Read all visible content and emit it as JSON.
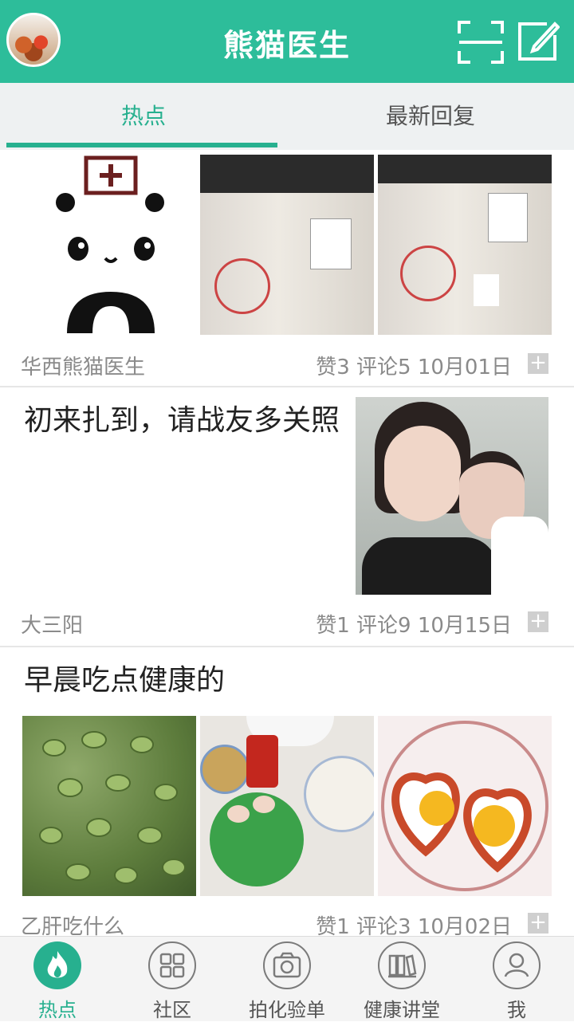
{
  "header": {
    "title": "熊猫医生"
  },
  "tabs": {
    "hot": "热点",
    "latest_reply": "最新回复"
  },
  "posts": [
    {
      "author": "华西熊猫医生",
      "stats": "赞3 评论5 10月01日"
    },
    {
      "title": "初来扎到，请战友多关照",
      "author": "大三阳",
      "stats": "赞1 评论9 10月15日"
    },
    {
      "title": "早晨吃点健康的",
      "author": "乙肝吃什么",
      "stats": "赞1 评论3 10月02日"
    }
  ],
  "nav": {
    "items": [
      {
        "label": "热点",
        "icon": "flame-icon"
      },
      {
        "label": "社区",
        "icon": "grid-icon"
      },
      {
        "label": "拍化验单",
        "icon": "camera-icon"
      },
      {
        "label": "健康讲堂",
        "icon": "books-icon"
      },
      {
        "label": "我",
        "icon": "user-icon"
      }
    ]
  },
  "colors": {
    "brand": "#2dbd9a",
    "accent": "#27b08f"
  }
}
